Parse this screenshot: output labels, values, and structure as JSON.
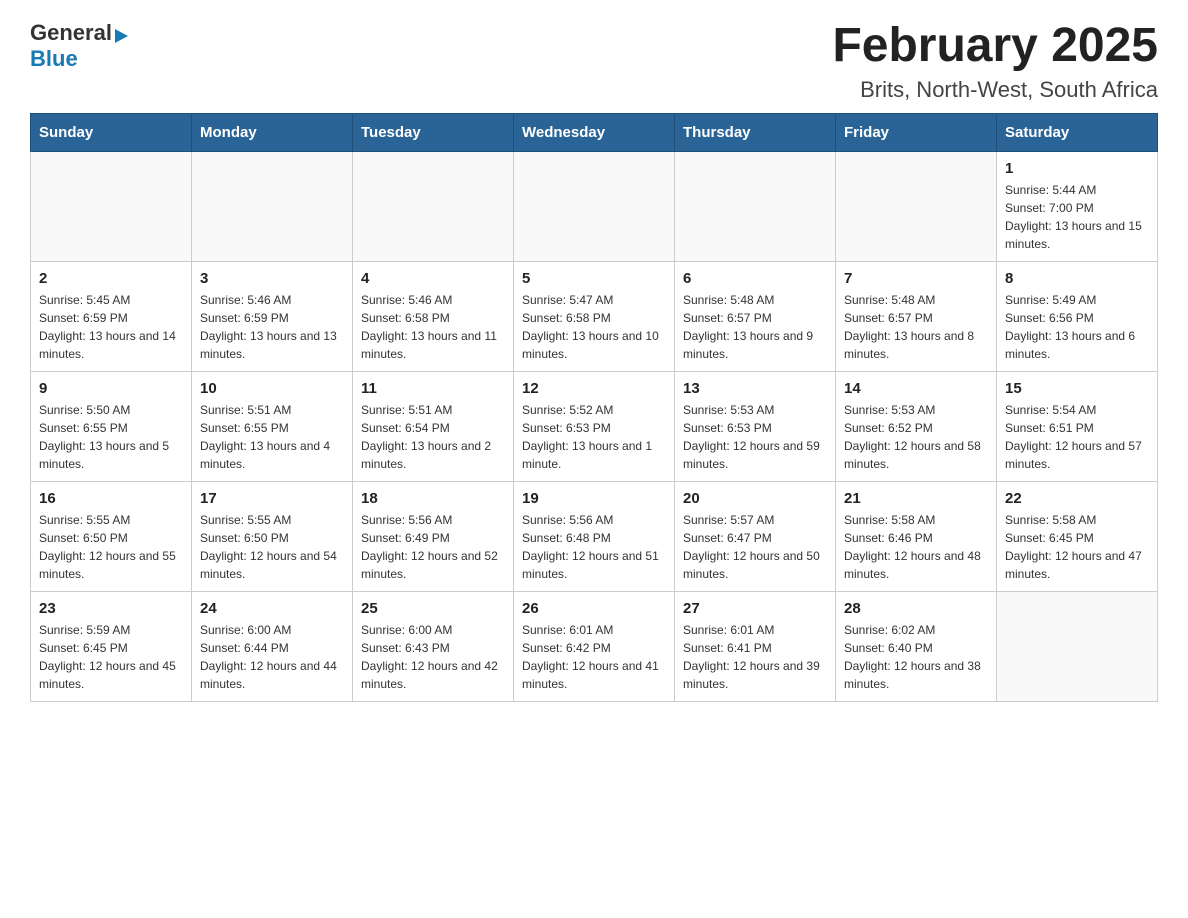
{
  "header": {
    "logo_general": "General",
    "logo_blue": "Blue",
    "main_title": "February 2025",
    "subtitle": "Brits, North-West, South Africa"
  },
  "weekdays": [
    "Sunday",
    "Monday",
    "Tuesday",
    "Wednesday",
    "Thursday",
    "Friday",
    "Saturday"
  ],
  "weeks": [
    [
      {
        "day": "",
        "info": ""
      },
      {
        "day": "",
        "info": ""
      },
      {
        "day": "",
        "info": ""
      },
      {
        "day": "",
        "info": ""
      },
      {
        "day": "",
        "info": ""
      },
      {
        "day": "",
        "info": ""
      },
      {
        "day": "1",
        "info": "Sunrise: 5:44 AM\nSunset: 7:00 PM\nDaylight: 13 hours and 15 minutes."
      }
    ],
    [
      {
        "day": "2",
        "info": "Sunrise: 5:45 AM\nSunset: 6:59 PM\nDaylight: 13 hours and 14 minutes."
      },
      {
        "day": "3",
        "info": "Sunrise: 5:46 AM\nSunset: 6:59 PM\nDaylight: 13 hours and 13 minutes."
      },
      {
        "day": "4",
        "info": "Sunrise: 5:46 AM\nSunset: 6:58 PM\nDaylight: 13 hours and 11 minutes."
      },
      {
        "day": "5",
        "info": "Sunrise: 5:47 AM\nSunset: 6:58 PM\nDaylight: 13 hours and 10 minutes."
      },
      {
        "day": "6",
        "info": "Sunrise: 5:48 AM\nSunset: 6:57 PM\nDaylight: 13 hours and 9 minutes."
      },
      {
        "day": "7",
        "info": "Sunrise: 5:48 AM\nSunset: 6:57 PM\nDaylight: 13 hours and 8 minutes."
      },
      {
        "day": "8",
        "info": "Sunrise: 5:49 AM\nSunset: 6:56 PM\nDaylight: 13 hours and 6 minutes."
      }
    ],
    [
      {
        "day": "9",
        "info": "Sunrise: 5:50 AM\nSunset: 6:55 PM\nDaylight: 13 hours and 5 minutes."
      },
      {
        "day": "10",
        "info": "Sunrise: 5:51 AM\nSunset: 6:55 PM\nDaylight: 13 hours and 4 minutes."
      },
      {
        "day": "11",
        "info": "Sunrise: 5:51 AM\nSunset: 6:54 PM\nDaylight: 13 hours and 2 minutes."
      },
      {
        "day": "12",
        "info": "Sunrise: 5:52 AM\nSunset: 6:53 PM\nDaylight: 13 hours and 1 minute."
      },
      {
        "day": "13",
        "info": "Sunrise: 5:53 AM\nSunset: 6:53 PM\nDaylight: 12 hours and 59 minutes."
      },
      {
        "day": "14",
        "info": "Sunrise: 5:53 AM\nSunset: 6:52 PM\nDaylight: 12 hours and 58 minutes."
      },
      {
        "day": "15",
        "info": "Sunrise: 5:54 AM\nSunset: 6:51 PM\nDaylight: 12 hours and 57 minutes."
      }
    ],
    [
      {
        "day": "16",
        "info": "Sunrise: 5:55 AM\nSunset: 6:50 PM\nDaylight: 12 hours and 55 minutes."
      },
      {
        "day": "17",
        "info": "Sunrise: 5:55 AM\nSunset: 6:50 PM\nDaylight: 12 hours and 54 minutes."
      },
      {
        "day": "18",
        "info": "Sunrise: 5:56 AM\nSunset: 6:49 PM\nDaylight: 12 hours and 52 minutes."
      },
      {
        "day": "19",
        "info": "Sunrise: 5:56 AM\nSunset: 6:48 PM\nDaylight: 12 hours and 51 minutes."
      },
      {
        "day": "20",
        "info": "Sunrise: 5:57 AM\nSunset: 6:47 PM\nDaylight: 12 hours and 50 minutes."
      },
      {
        "day": "21",
        "info": "Sunrise: 5:58 AM\nSunset: 6:46 PM\nDaylight: 12 hours and 48 minutes."
      },
      {
        "day": "22",
        "info": "Sunrise: 5:58 AM\nSunset: 6:45 PM\nDaylight: 12 hours and 47 minutes."
      }
    ],
    [
      {
        "day": "23",
        "info": "Sunrise: 5:59 AM\nSunset: 6:45 PM\nDaylight: 12 hours and 45 minutes."
      },
      {
        "day": "24",
        "info": "Sunrise: 6:00 AM\nSunset: 6:44 PM\nDaylight: 12 hours and 44 minutes."
      },
      {
        "day": "25",
        "info": "Sunrise: 6:00 AM\nSunset: 6:43 PM\nDaylight: 12 hours and 42 minutes."
      },
      {
        "day": "26",
        "info": "Sunrise: 6:01 AM\nSunset: 6:42 PM\nDaylight: 12 hours and 41 minutes."
      },
      {
        "day": "27",
        "info": "Sunrise: 6:01 AM\nSunset: 6:41 PM\nDaylight: 12 hours and 39 minutes."
      },
      {
        "day": "28",
        "info": "Sunrise: 6:02 AM\nSunset: 6:40 PM\nDaylight: 12 hours and 38 minutes."
      },
      {
        "day": "",
        "info": ""
      }
    ]
  ]
}
